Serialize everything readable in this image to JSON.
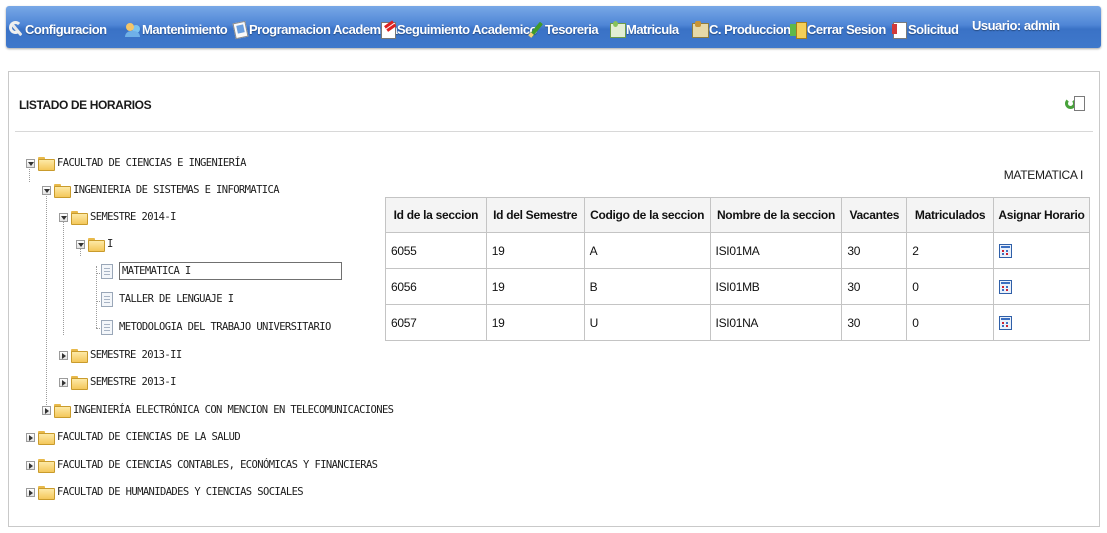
{
  "nav": {
    "items": [
      {
        "label": "Configuracion",
        "icon": "wrench-icon"
      },
      {
        "label": "Mantenimiento",
        "icon": "people-icon"
      },
      {
        "label": "Programacion Academica",
        "icon": "book-icon"
      },
      {
        "label": "Seguimiento Academico",
        "icon": "note-icon"
      },
      {
        "label": "Tesoreria",
        "icon": "pencil-icon"
      },
      {
        "label": "Matricula",
        "icon": "enrollment-icon"
      },
      {
        "label": "C. Produccion",
        "icon": "production-icon"
      },
      {
        "label": "Cerrar Sesion",
        "icon": "logout-icon"
      },
      {
        "label": "Solicitud",
        "icon": "form-icon"
      }
    ],
    "user": "Usuario: admin"
  },
  "page": {
    "title": "LISTADO DE HORARIOS",
    "refresh_icon": "refresh-icon",
    "selected_course": "MATEMATICA I"
  },
  "tree": {
    "faculty_1": "FACULTAD DE CIENCIAS E INGENIERÍA",
    "school_1": "INGENIERIA DE SISTEMAS E INFORMATICA",
    "semester_1": "SEMESTRE 2014-I",
    "cycle_1": "I",
    "course_1": "MATEMATICA I",
    "course_2": "TALLER DE LENGUAJE I",
    "course_3": "METODOLOGIA DEL TRABAJO UNIVERSITARIO",
    "semester_2": "SEMESTRE 2013-II",
    "semester_3": "SEMESTRE 2013-I",
    "school_2": "INGENIERÍA ELECTRÓNICA CON MENCION EN TELECOMUNICACIONES",
    "faculty_2": "FACULTAD DE CIENCIAS DE LA SALUD",
    "faculty_3": "FACULTAD DE CIENCIAS CONTABLES, ECONÓMICAS Y FINANCIERAS",
    "faculty_4": "FACULTAD DE HUMANIDADES Y CIENCIAS SOCIALES"
  },
  "table": {
    "headers": [
      "Id de la seccion",
      "Id del Semestre",
      "Codigo de la seccion",
      "Nombre de la seccion",
      "Vacantes",
      "Matriculados",
      "Asignar Horario"
    ],
    "rows": [
      {
        "id": "6055",
        "semester": "19",
        "code": "A",
        "name": "ISI01MA",
        "vacancies": "30",
        "enrolled": "2"
      },
      {
        "id": "6056",
        "semester": "19",
        "code": "B",
        "name": "ISI01MB",
        "vacancies": "30",
        "enrolled": "0"
      },
      {
        "id": "6057",
        "semester": "19",
        "code": "U",
        "name": "ISI01NA",
        "vacancies": "30",
        "enrolled": "0"
      }
    ],
    "action_icon": "schedule-icon"
  }
}
